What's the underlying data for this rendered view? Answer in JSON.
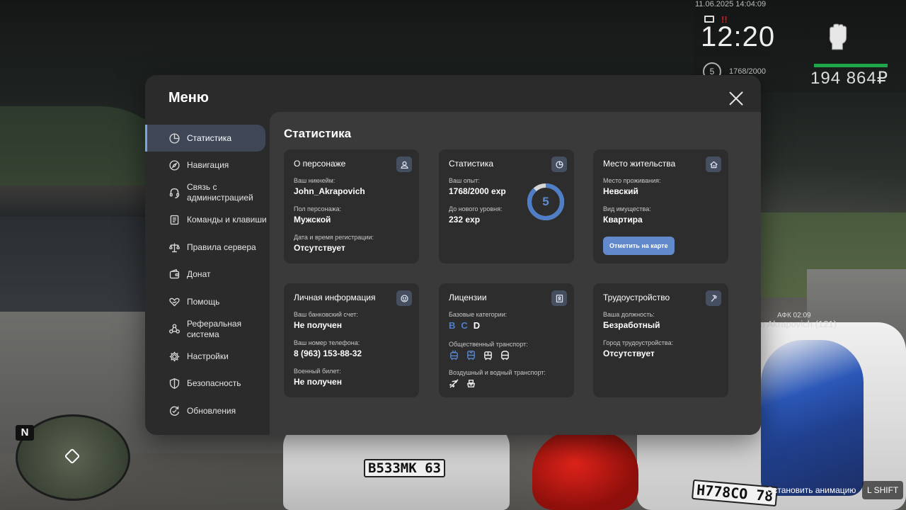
{
  "hud": {
    "datetime": "11.06.2025 14:04:09",
    "notify_count": "!!",
    "clock": "12:20",
    "level": "5",
    "exp": "1768/2000",
    "money": "194 864₽",
    "player_tag": "АФК 02:09",
    "player_name": "m Akrapovich (121)",
    "stop_animation": "Остановить анимацию",
    "key_hint": "L SHIFT",
    "minimap_north": "N",
    "plate_front": "В533МК 63",
    "plate_right": "Н778СО 78"
  },
  "menu": {
    "title": "Меню",
    "sidebar": {
      "items": [
        {
          "label": "Статистика",
          "icon": "chart-pie-icon",
          "active": true
        },
        {
          "label": "Навигация",
          "icon": "compass-icon"
        },
        {
          "label": "Связь с администрацией",
          "icon": "headset-icon"
        },
        {
          "label": "Команды и клавиши",
          "icon": "document-icon"
        },
        {
          "label": "Правила сервера",
          "icon": "scales-icon"
        },
        {
          "label": "Донат",
          "icon": "wallet-icon"
        },
        {
          "label": "Помощь",
          "icon": "heart-hand-icon"
        },
        {
          "label": "Реферальная система",
          "icon": "referral-icon"
        },
        {
          "label": "Настройки",
          "icon": "gear-icon"
        },
        {
          "label": "Безопасность",
          "icon": "shield-icon"
        },
        {
          "label": "Обновления",
          "icon": "update-icon"
        }
      ]
    },
    "content": {
      "title": "Статистика",
      "character": {
        "title": "О персонаже",
        "nickname_label": "Ваш никнейм:",
        "nickname": "John_Akrapovich",
        "gender_label": "Пол персонажа:",
        "gender": "Мужской",
        "registered_label": "Дата и время регистрации:",
        "registered": "Отсутствует"
      },
      "stats": {
        "title": "Статистика",
        "exp_label": "Ваш опыт:",
        "exp": "1768/2000 exp",
        "next_label": "До нового уровня:",
        "next": "232 exp",
        "level": "5",
        "progress": 0.884
      },
      "residence": {
        "title": "Место жительства",
        "place_label": "Место проживания:",
        "place": "Невский",
        "property_label": "Вид имущества:",
        "property": "Квартира",
        "map_button": "Отметить на карте"
      },
      "personal": {
        "title": "Личная информация",
        "bank_label": "Ваш банковский счет:",
        "bank": "Не получен",
        "phone_label": "Ваш номер телефона:",
        "phone": "8 (963) 153-88-32",
        "military_label": "Военный билет:",
        "military": "Не получен"
      },
      "licenses": {
        "title": "Лицензии",
        "basic_label": "Базовые категории:",
        "categories": [
          {
            "letter": "B",
            "owned": true
          },
          {
            "letter": "C",
            "owned": true
          },
          {
            "letter": "D",
            "owned": false
          }
        ],
        "public_label": "Общественный транспорт:",
        "air_water_label": "Воздушный и водный транспорт:"
      },
      "employment": {
        "title": "Трудоустройство",
        "position_label": "Ваша должность:",
        "position": "Безработный",
        "city_label": "Город трудоустройства:",
        "city": "Отсутствует"
      }
    }
  },
  "colors": {
    "accent": "#6189cb",
    "active_bg": "#3f4757",
    "panel": "#2b2b2c",
    "content": "#3a3a3b",
    "card": "#2d2d2e",
    "money_bar": "#1fa54a"
  }
}
